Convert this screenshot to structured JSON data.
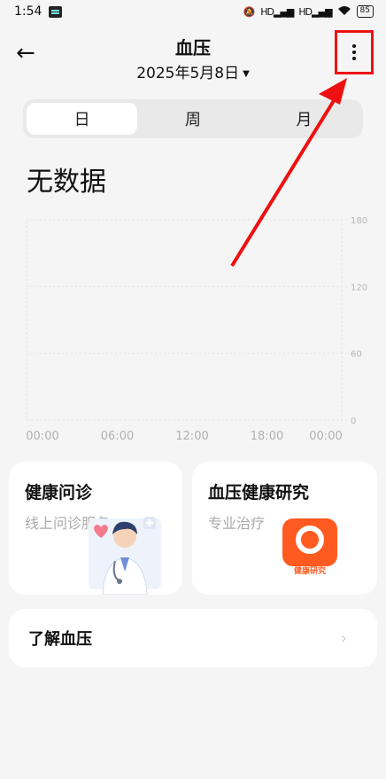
{
  "status_bar": {
    "time": "1:54",
    "battery": "85",
    "signal_1": "HD",
    "signal_2": "HD"
  },
  "header": {
    "title": "血压",
    "date": "2025年5月8日",
    "back_glyph": "←"
  },
  "tabs": [
    {
      "label": "日",
      "active": true
    },
    {
      "label": "周",
      "active": false
    },
    {
      "label": "月",
      "active": false
    }
  ],
  "empty_state": "无数据",
  "chart_data": {
    "type": "line",
    "x_ticks": [
      "00:00",
      "06:00",
      "12:00",
      "18:00",
      "00:00"
    ],
    "y_ticks": [
      180,
      120,
      60,
      0
    ],
    "ylim": [
      0,
      180
    ],
    "series": [],
    "grid": true
  },
  "cards": {
    "consult": {
      "title": "健康问诊",
      "subtitle": "线上问诊服务"
    },
    "research": {
      "title": "血压健康研究",
      "subtitle": "专业治疗",
      "icon_text": "健康研究"
    }
  },
  "learn_row": {
    "label": "了解血压"
  },
  "colors": {
    "annotation_red": "#ee1111",
    "research_orange": "#ff5a1f"
  }
}
